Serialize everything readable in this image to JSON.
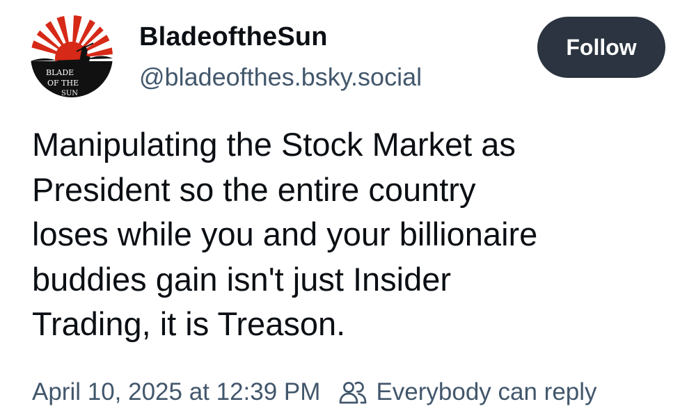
{
  "author": {
    "display_name": "BladeoftheSun",
    "handle": "@bladeofthes.bsky.social",
    "avatar_text": "BLADE OF THE SUN"
  },
  "actions": {
    "follow_label": "Follow"
  },
  "post": {
    "text": "Manipulating the Stock Market as\nPresident so the entire country\nloses while you and your billionaire\nbuddies gain isn't just Insider\nTrading, it is Treason.",
    "timestamp": "April 10, 2025 at 12:39 PM",
    "reply_setting": "Everybody can reply"
  },
  "colors": {
    "text": "#0b0f14",
    "muted": "#42576c",
    "follow_button_bg": "#2b3440",
    "follow_button_text": "#ffffff",
    "avatar_red": "#d62918"
  }
}
